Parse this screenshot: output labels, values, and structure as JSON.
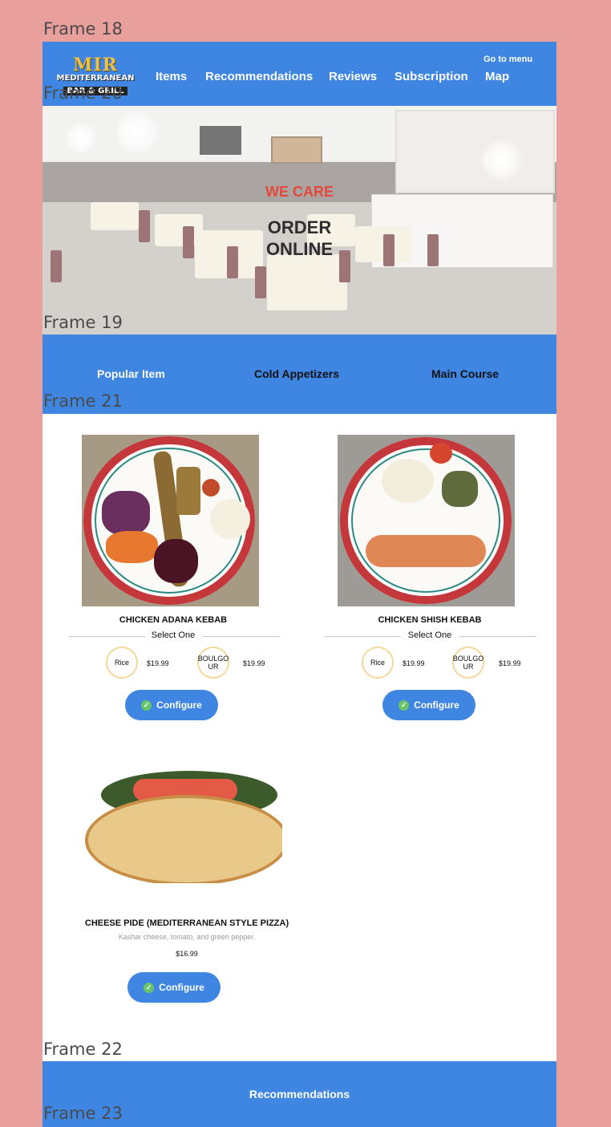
{
  "frames": {
    "f18": "Frame 18",
    "f20": "Frame 20",
    "f19": "Frame 19",
    "f21": "Frame 21",
    "f22": "Frame 22",
    "f23": "Frame 23"
  },
  "header": {
    "logo": {
      "main": "MIR",
      "line1": "MEDITERRANEAN",
      "line2": "BAR & GRILL"
    },
    "nav": [
      "Items",
      "Recommendations",
      "Reviews",
      "Subscription",
      "Map"
    ],
    "goto_menu": "Go to menu"
  },
  "hero": {
    "tagline": "WE CARE",
    "cta_line1": "ORDER",
    "cta_line2": "ONLINE"
  },
  "tabs": [
    {
      "label": "Popular Item",
      "active": true
    },
    {
      "label": "Cold Appetizers",
      "active": false
    },
    {
      "label": "Main Course",
      "active": false
    }
  ],
  "items": [
    {
      "title": "CHICKEN ADANA KEBAB",
      "select_label": "Select One",
      "options": [
        {
          "name": "Rice",
          "price": "$19.99"
        },
        {
          "name": "BOULGO UR",
          "price": "$19.99"
        }
      ],
      "button": "Configure"
    },
    {
      "title": "CHICKEN SHISH KEBAB",
      "select_label": "Select One",
      "options": [
        {
          "name": "Rice",
          "price": "$19.99"
        },
        {
          "name": "BOULGO UR",
          "price": "$19.99"
        }
      ],
      "button": "Configure"
    },
    {
      "title": "CHEESE PIDE (MEDITERRANEAN STYLE PIZZA)",
      "description": "Kashar cheese, tomato, and green pepper.",
      "price": "$16.99",
      "button": "Configure"
    }
  ],
  "recommendations": {
    "title": "Recommendations"
  },
  "colors": {
    "page_bg": "#e9a09c",
    "accent_blue": "#3f86e3",
    "highlight_red": "#e24a3c",
    "option_ring": "#f2d99a",
    "check_green": "#6ac46a"
  },
  "icons": [
    "check-circle-icon"
  ]
}
